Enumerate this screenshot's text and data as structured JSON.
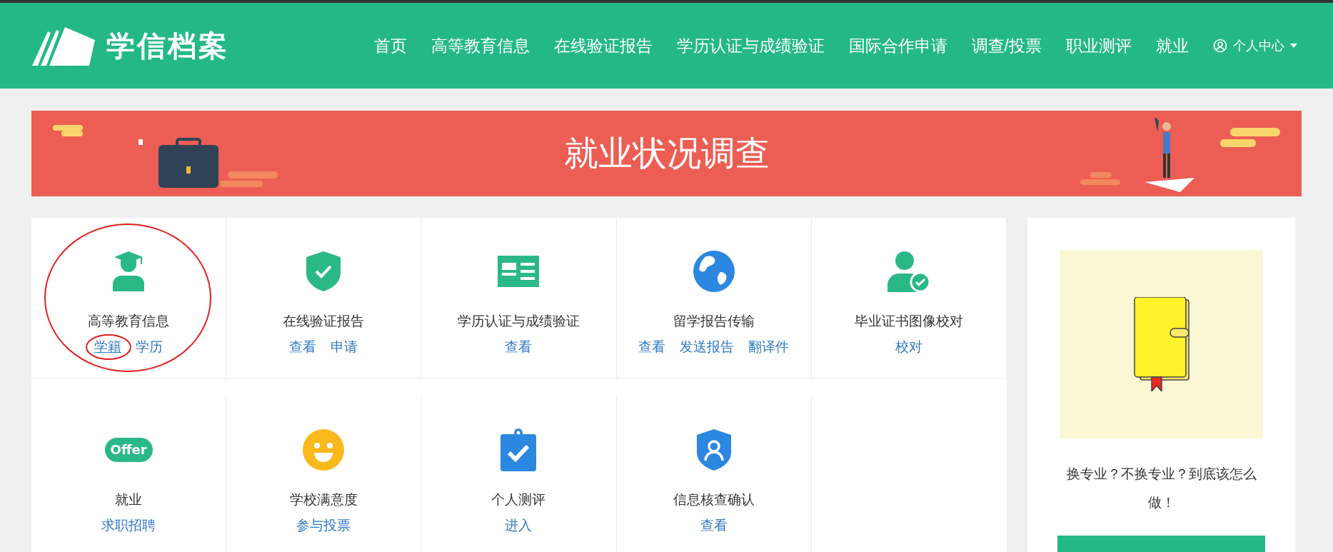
{
  "header": {
    "logo_text": "学信档案",
    "nav": [
      {
        "label": "首页",
        "selected": false
      },
      {
        "label": "高等教育信息",
        "selected": false
      },
      {
        "label": "在线验证报告",
        "selected": false
      },
      {
        "label": "学历认证与成绩验证",
        "selected": false
      },
      {
        "label": "国际合作申请",
        "selected": false
      },
      {
        "label": "调查/投票",
        "selected": false
      },
      {
        "label": "职业测评",
        "selected": false
      },
      {
        "label": "就业",
        "selected": false
      }
    ],
    "user_menu": "个人中心"
  },
  "banner": {
    "title": "就业状况调查"
  },
  "services": [
    {
      "kind": "graduate",
      "title": "高等教育信息",
      "circled": true,
      "links": [
        {
          "label": "学籍",
          "circled": true
        },
        {
          "label": "学历",
          "circled": false
        }
      ]
    },
    {
      "kind": "shield",
      "title": "在线验证报告",
      "circled": false,
      "links": [
        {
          "label": "查看",
          "circled": false
        },
        {
          "label": "申请",
          "circled": false
        }
      ]
    },
    {
      "kind": "card",
      "title": "学历认证与成绩验证",
      "circled": false,
      "links": [
        {
          "label": "查看",
          "circled": false
        }
      ]
    },
    {
      "kind": "globe",
      "title": "留学报告传输",
      "circled": false,
      "links": [
        {
          "label": "查看",
          "circled": false
        },
        {
          "label": "发送报告",
          "circled": false
        },
        {
          "label": "翻译件",
          "circled": false
        }
      ]
    },
    {
      "kind": "user-check",
      "title": "毕业证书图像校对",
      "circled": false,
      "links": [
        {
          "label": "校对",
          "circled": false
        }
      ]
    },
    {
      "kind": "offer",
      "title": "就业",
      "icon_text": "Offer",
      "circled": false,
      "links": [
        {
          "label": "求职招聘",
          "circled": false
        }
      ]
    },
    {
      "kind": "smile",
      "title": "学校满意度",
      "circled": false,
      "links": [
        {
          "label": "参与投票",
          "circled": false
        }
      ]
    },
    {
      "kind": "clipboard",
      "title": "个人测评",
      "circled": false,
      "links": [
        {
          "label": "进入",
          "circled": false
        }
      ]
    },
    {
      "kind": "badge",
      "title": "信息核查确认",
      "circled": false,
      "links": [
        {
          "label": "查看",
          "circled": false
        }
      ]
    }
  ],
  "sidebar": {
    "caption": "换专业？不换专业？到底该怎么做！"
  }
}
